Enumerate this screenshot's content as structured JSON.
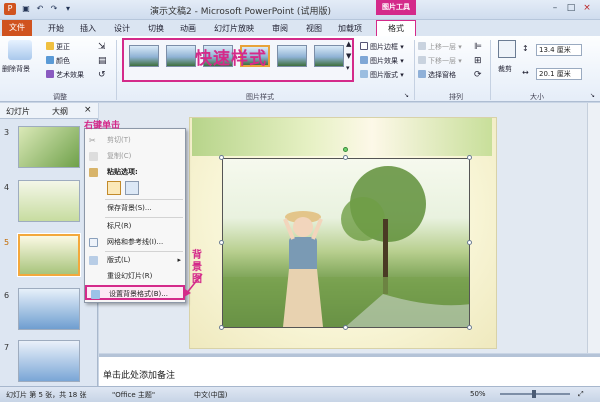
{
  "app": {
    "title": "演示文稿2 - Microsoft PowerPoint (试用版)",
    "context_tool": "图片工具",
    "window_controls": [
      "–",
      "□",
      "×"
    ]
  },
  "tabs": [
    "文件",
    "开始",
    "插入",
    "设计",
    "切换",
    "动画",
    "幻灯片放映",
    "审阅",
    "视图",
    "加载项",
    "格式"
  ],
  "ribbon": {
    "adjust": {
      "remove_bg": "删除背景",
      "corrections": "更正",
      "color": "颜色",
      "artistic": "艺术效果",
      "label": "调整"
    },
    "styles": {
      "overlay": "快速样式",
      "border": "图片边框",
      "effects": "图片效果",
      "layout": "图片版式",
      "label": "图片样式"
    },
    "arrange": {
      "bring_forward": "上移一层",
      "send_backward": "下移一层",
      "selection_pane": "选择窗格",
      "label": "排列"
    },
    "size": {
      "crop": "裁剪",
      "height": "13.4 厘米",
      "width": "20.1 厘米",
      "label": "大小"
    }
  },
  "panel": {
    "tab_slides": "幻灯片",
    "tab_outline": "大纲",
    "slide_numbers": [
      "3",
      "4",
      "5",
      "6",
      "7"
    ],
    "active_slide": "5"
  },
  "context_menu": {
    "annotation": "右键单击",
    "items": [
      {
        "label": "剪切(T)",
        "disabled": true
      },
      {
        "label": "复制(C)",
        "disabled": true
      },
      {
        "label": "粘贴选项:",
        "disabled": false
      },
      {
        "label": "保存背景(S)...",
        "disabled": false
      },
      {
        "label": "标尺(R)",
        "disabled": false
      },
      {
        "label": "网格和参考线(I)...",
        "disabled": false
      },
      {
        "label": "版式(L)",
        "disabled": false
      },
      {
        "label": "重设幻灯片(R)",
        "disabled": false
      },
      {
        "label": "设置背景格式(B)...",
        "disabled": false
      }
    ]
  },
  "annotation_bg": [
    "背",
    "景",
    "图"
  ],
  "notes_placeholder": "单击此处添加备注",
  "status": {
    "slide_info": "幻灯片 第 5 张，共 18 张",
    "theme": "\"Office 主题\"",
    "language": "中文(中国)",
    "zoom": "50%"
  },
  "colors": {
    "accent": "#d42a8a",
    "file_tab": "#d0531f",
    "selected": "#f3a83c"
  }
}
